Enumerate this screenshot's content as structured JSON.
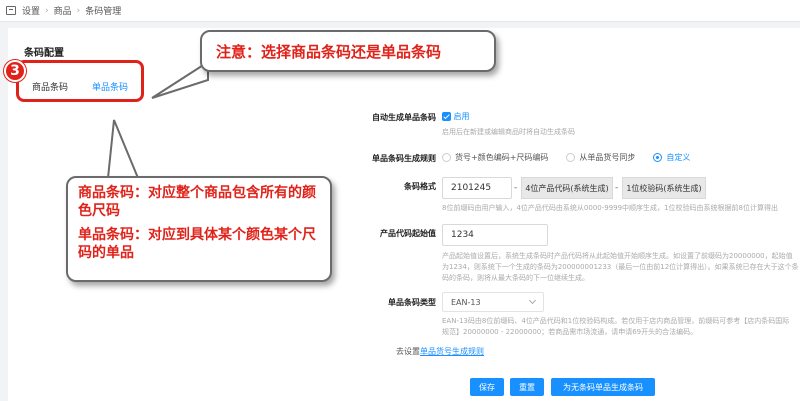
{
  "breadcrumb": [
    "设置",
    "商品",
    "条码管理"
  ],
  "panel_title": "条码配置",
  "tabs": [
    {
      "label": "商品条码"
    },
    {
      "label": "单品条码"
    }
  ],
  "annotation": {
    "badge": "3",
    "callout1": "注意：选择商品条码还是单品条码",
    "callout2_line1": "商品条码：对应整个商品包含所有的颜色尺码",
    "callout2_line2": "单品条码：对应到具体某个颜色某个尺码的单品"
  },
  "auto_gen": {
    "label": "自动生成单品条码",
    "checkbox_label": "启用",
    "hint": "启用后在新建或编辑商品时将自动生成条码"
  },
  "rule": {
    "label": "单品条码生成规则",
    "options": [
      "货号+颜色编码+尺码编码",
      "从单品货号同步",
      "自定义"
    ]
  },
  "format": {
    "label": "条码格式",
    "value": "2101245",
    "part2": "4位产品代码(系统生成)",
    "part3": "1位校验码(系统生成)",
    "hint": "8位前缀码由用户输入，4位产品代码由系统从0000-9999中顺序生成，1位校验码由系统根据前8位计算得出"
  },
  "start": {
    "label": "产品代码起始值",
    "value": "1234",
    "hint_line1": "产品起始值设置后，系统生成条码时产品代码将从此起始值开始顺序生成。如设置了前缀码为20000000，起始值",
    "hint_line2": "为1234，则系统下一个生成的条码为200000001233（最后一位由前12位计算得出）。如果系统已存在大于这个条",
    "hint_line3": "码的条码，则将从最大条码的下一位继续生成。"
  },
  "type": {
    "label": "单品条码类型",
    "value": "EAN-13",
    "hint_line1": "EAN-13码由8位前缀码、4位产品代码和1位校验码构成。若仅用于店内商品管理，前缀码可参考【店内条码国际",
    "hint_line2": "规范】20000000 - 22000000；若商品需市场流通，请申请69开头的合法编码。"
  },
  "goto": {
    "prefix": "去设置",
    "link": "单品货号生成规则"
  },
  "buttons": {
    "save": "保存",
    "reset": "重置",
    "generate": "为无条码单品生成条码"
  },
  "colors": {
    "accent": "#1890ff",
    "annotation_red": "#e0231a"
  }
}
